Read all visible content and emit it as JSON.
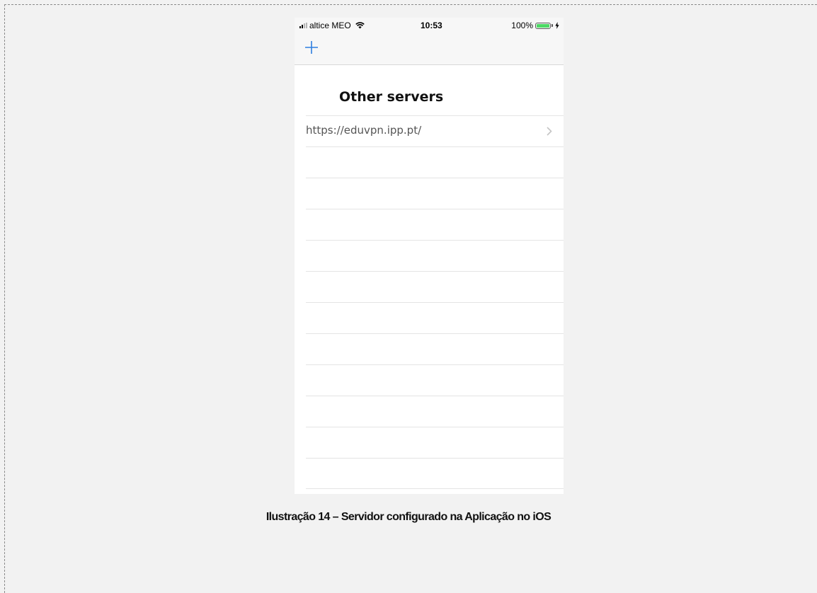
{
  "status_bar": {
    "carrier": "altice MEO",
    "time": "10:53",
    "battery_percent": "100%",
    "battery_level": 1.0,
    "battery_color": "#4cd964",
    "signal_bars_filled": 2,
    "signal_bars_total": 4
  },
  "nav": {
    "add_icon": "plus-icon",
    "accent_color": "#2f7fe0"
  },
  "section": {
    "title": "Other servers"
  },
  "servers": [
    {
      "label": "https://eduvpn.ipp.pt/"
    }
  ],
  "caption": {
    "text": "Ilustração 14 – Servidor configurado na Aplicação no iOS"
  }
}
